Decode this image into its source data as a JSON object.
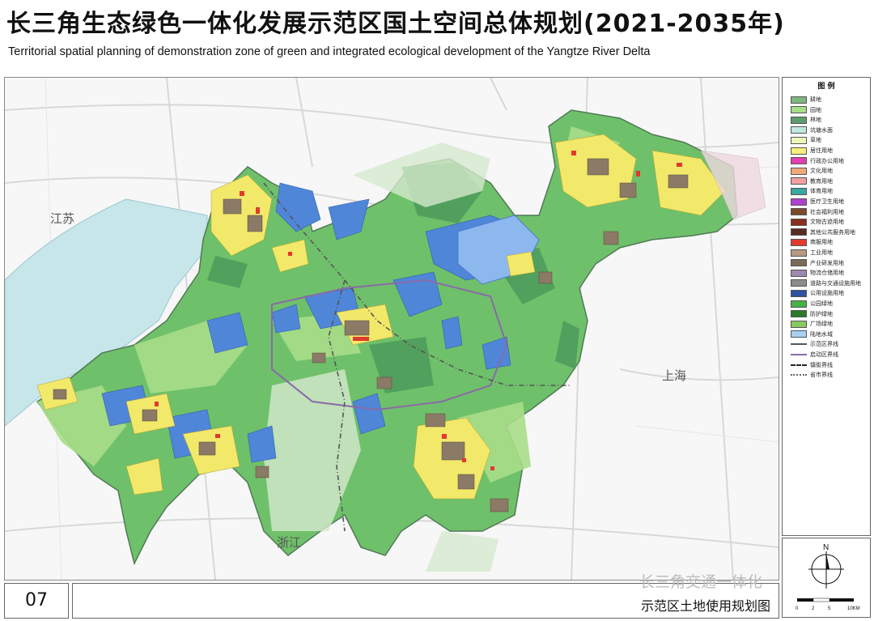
{
  "header": {
    "title_cn": "长三角生态绿色一体化发展示范区国土空间总体规划(2021-2035年)",
    "title_en": "Territorial  spatial planning of demonstration zone of green and integrated ecological development of the Yangtze River Delta"
  },
  "map": {
    "labels": {
      "jiangsu": "江苏",
      "shanghai": "上海",
      "zhejiang": "浙江"
    }
  },
  "legend": {
    "title": "图 例",
    "items": [
      {
        "label": "耕地",
        "color": "#7fb77e",
        "type": "fill"
      },
      {
        "label": "园地",
        "color": "#a8dd8a",
        "type": "fill"
      },
      {
        "label": "林地",
        "color": "#5f9c6c",
        "type": "fill"
      },
      {
        "label": "坑塘水面",
        "color": "#bfe8e0",
        "type": "fill"
      },
      {
        "label": "草地",
        "color": "#eef5b8",
        "type": "fill"
      },
      {
        "label": "居住用地",
        "color": "#f6f07a",
        "type": "fill"
      },
      {
        "label": "行政办公用地",
        "color": "#e040b0",
        "type": "fill"
      },
      {
        "label": "文化用地",
        "color": "#f2a97a",
        "type": "fill"
      },
      {
        "label": "教育用地",
        "color": "#f0a0a0",
        "type": "fill"
      },
      {
        "label": "体育用地",
        "color": "#3aa6a0",
        "type": "fill"
      },
      {
        "label": "医疗卫生用地",
        "color": "#b040d0",
        "type": "fill"
      },
      {
        "label": "社会福利用地",
        "color": "#7a4a2a",
        "type": "fill"
      },
      {
        "label": "文物古迹用地",
        "color": "#8a3020",
        "type": "fill"
      },
      {
        "label": "其他公共服务用地",
        "color": "#5a2a20",
        "type": "fill"
      },
      {
        "label": "商服用地",
        "color": "#e03a30",
        "type": "fill"
      },
      {
        "label": "工业用地",
        "color": "#b49a80",
        "type": "fill"
      },
      {
        "label": "产业研发用地",
        "color": "#7a6a58",
        "type": "fill"
      },
      {
        "label": "物流仓储用地",
        "color": "#9a8ab0",
        "type": "fill"
      },
      {
        "label": "道路与交通设施用地",
        "color": "#8c8c8c",
        "type": "fill"
      },
      {
        "label": "公用设施用地",
        "color": "#3050a0",
        "type": "fill"
      },
      {
        "label": "公园绿地",
        "color": "#48b048",
        "type": "fill"
      },
      {
        "label": "防护绿地",
        "color": "#2a7a2a",
        "type": "fill"
      },
      {
        "label": "广场绿地",
        "color": "#88c860",
        "type": "fill"
      },
      {
        "label": "陆地水域",
        "color": "#a8d0f0",
        "type": "fill"
      },
      {
        "label": "示范区界线",
        "color": "#555555",
        "type": "line"
      },
      {
        "label": "启动区界线",
        "color": "#8a6aa8",
        "type": "line"
      },
      {
        "label": "镇街界线",
        "color": "#222222",
        "type": "dash"
      },
      {
        "label": "省市界线",
        "color": "#666666",
        "type": "dotline"
      }
    ]
  },
  "north_arrow": {
    "label": "N"
  },
  "scale_bar": {
    "ticks": [
      "0",
      "2",
      "5",
      "10KM"
    ]
  },
  "footer": {
    "figure_number": "07",
    "caption": "示范区土地使用规划图",
    "watermark": "长三角交通一体化"
  }
}
